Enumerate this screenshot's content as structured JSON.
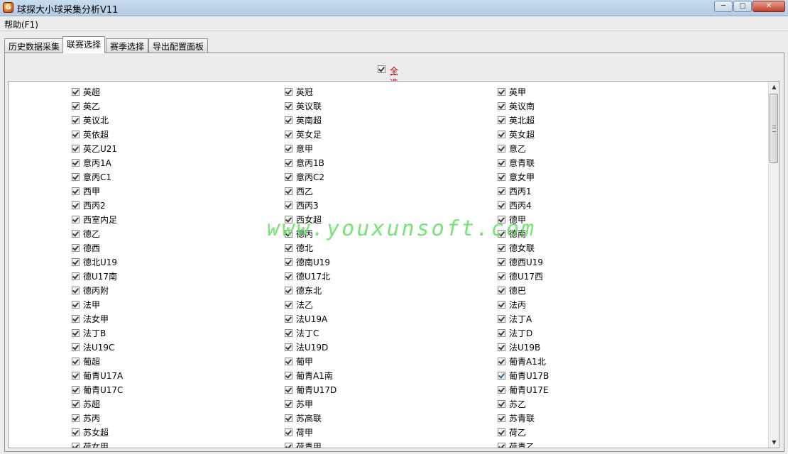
{
  "window": {
    "title": "球探大小球采集分析V11",
    "icon": "app-logo-icon"
  },
  "menu": {
    "help": "帮助(F1)"
  },
  "tabs": [
    {
      "label": "历史数据采集",
      "active": false
    },
    {
      "label": "联赛选择",
      "active": true
    },
    {
      "label": "赛季选择",
      "active": false
    },
    {
      "label": "导出配置面板",
      "active": false
    }
  ],
  "select_all": {
    "label": "全选",
    "checked": true
  },
  "leagues": [
    [
      "英超",
      "英冠",
      "英甲"
    ],
    [
      "英乙",
      "英议联",
      "英议南"
    ],
    [
      "英议北",
      "英南超",
      "英北超"
    ],
    [
      "英依超",
      "英女足",
      "英女超"
    ],
    [
      "英乙U21",
      "意甲",
      "意乙"
    ],
    [
      "意丙1A",
      "意丙1B",
      "意青联"
    ],
    [
      "意丙C1",
      "意丙C2",
      "意女甲"
    ],
    [
      "西甲",
      "西乙",
      "西丙1"
    ],
    [
      "西丙2",
      "西丙3",
      "西丙4"
    ],
    [
      "西室内足",
      "西女超",
      "德甲"
    ],
    [
      "德乙",
      "德丙",
      "德南"
    ],
    [
      "德西",
      "德北",
      "德女联"
    ],
    [
      "德北U19",
      "德南U19",
      "德西U19"
    ],
    [
      "德U17南",
      "德U17北",
      "德U17西"
    ],
    [
      "德丙附",
      "德东北",
      "德巴"
    ],
    [
      "法甲",
      "法乙",
      "法丙"
    ],
    [
      "法女甲",
      "法U19A",
      "法丁A"
    ],
    [
      "法丁B",
      "法丁C",
      "法丁D"
    ],
    [
      "法U19C",
      "法U19D",
      "法U19B"
    ],
    [
      "葡超",
      "葡甲",
      "葡青A1北"
    ],
    [
      "葡青U17A",
      "葡青A1南",
      "葡青U17B"
    ],
    [
      "葡青U17C",
      "葡青U17D",
      "葡青U17E"
    ],
    [
      "苏超",
      "苏甲",
      "苏乙"
    ],
    [
      "苏丙",
      "苏高联",
      "苏青联"
    ],
    [
      "苏女超",
      "荷甲",
      "荷乙"
    ],
    [
      "荷女甲",
      "荷青甲",
      "荷青乙"
    ]
  ],
  "highlighted_checkbox": "葡青U17B",
  "watermark": "www.youxunsoft.com",
  "colors": {
    "select_all_label": "#c00000",
    "watermark": "#5fe05f",
    "titlebar": "#b3cbe3"
  }
}
